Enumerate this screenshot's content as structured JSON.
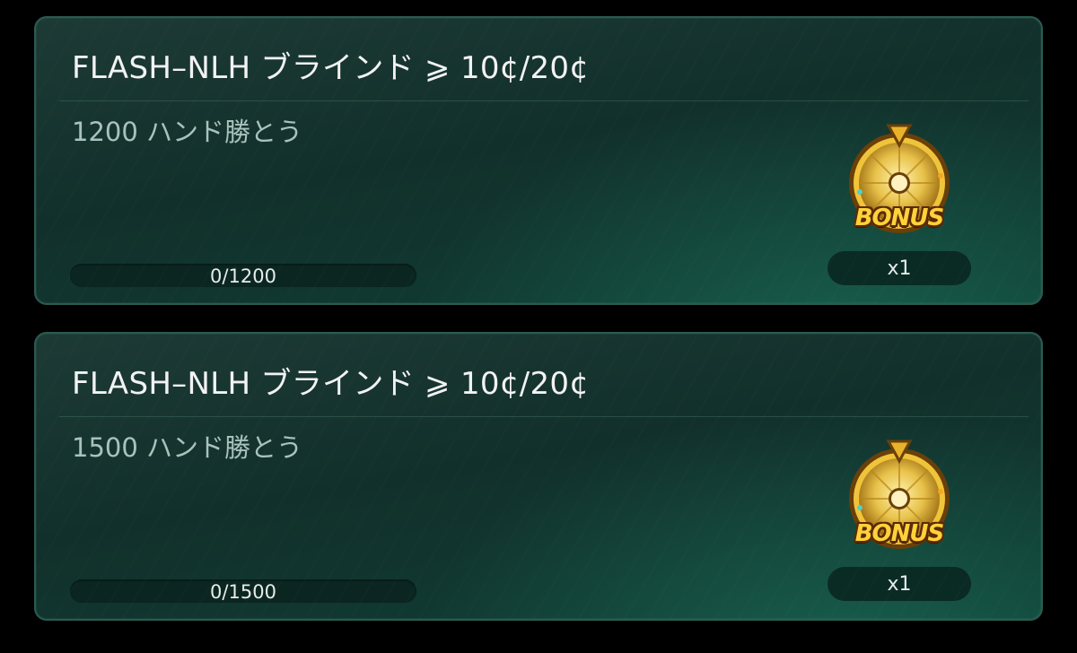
{
  "tasks": [
    {
      "title": "FLASH–NLH ブラインド ⩾ 10¢/20¢",
      "goal": "1200 ハンド勝とう",
      "progress_text": "0/1200",
      "progress_value": 0,
      "reward_icon": "bonus-wheel-icon",
      "reward_label": "BONUS",
      "reward_count": "x1"
    },
    {
      "title": "FLASH–NLH ブラインド ⩾ 10¢/20¢",
      "goal": "1500 ハンド勝とう",
      "progress_text": "0/1500",
      "progress_value": 0,
      "reward_icon": "bonus-wheel-icon",
      "reward_label": "BONUS",
      "reward_count": "x1"
    }
  ],
  "colors": {
    "card_bg": "#12302b",
    "title": "#f2f2f2",
    "subtitle": "#a9c2bc",
    "bonus_gold": "#ffd23a"
  }
}
